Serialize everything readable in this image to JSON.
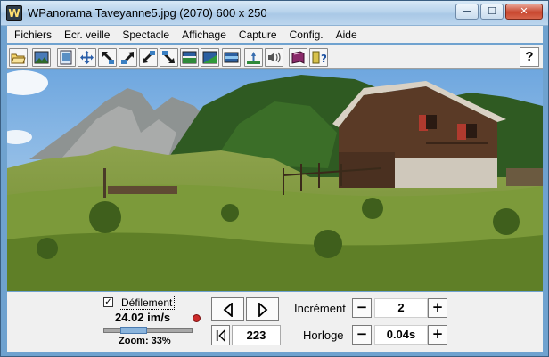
{
  "window": {
    "title": "WPanorama  Taveyanne5.jpg     (2070) 600 x 250",
    "app_icon_glyph": "W",
    "controls": {
      "minimize": "—",
      "maximize": "☐",
      "close": "✕"
    }
  },
  "menu": {
    "items": [
      "Fichiers",
      "Ecr. veille",
      "Spectacle",
      "Affichage",
      "Capture",
      "Config.",
      "Aide"
    ]
  },
  "toolbar": {
    "buttons": [
      "open-folder-icon",
      "landscape-image-icon",
      "fit-window-icon",
      "move-arrows-icon",
      "arrow-up-left-icon",
      "arrow-up-right-icon",
      "arrow-down-left-icon",
      "arrow-down-right-icon",
      "panorama-wide-icon",
      "panorama-tilt-icon",
      "panorama-strip-icon",
      "horizon-icon",
      "speaker-icon",
      "book-icon",
      "help-book-icon"
    ],
    "help_label": "?"
  },
  "controls": {
    "scroll_checkbox_checked": true,
    "scroll_checkbox_mark": "✓",
    "scroll_label": "Défilement",
    "speed": "24.02 im/s",
    "zoom_level": 0.33,
    "zoom_label": "Zoom: 33%",
    "frame_value": "223",
    "increment_label": "Incrément",
    "increment_value": "2",
    "clock_label": "Horloge",
    "clock_value": "0.04s",
    "minus": "−",
    "plus": "+"
  },
  "colors": {
    "title_bar": "#b8d3ec",
    "frame_blue": "#6fa2cf",
    "panel_gray": "#f0f0f0"
  }
}
